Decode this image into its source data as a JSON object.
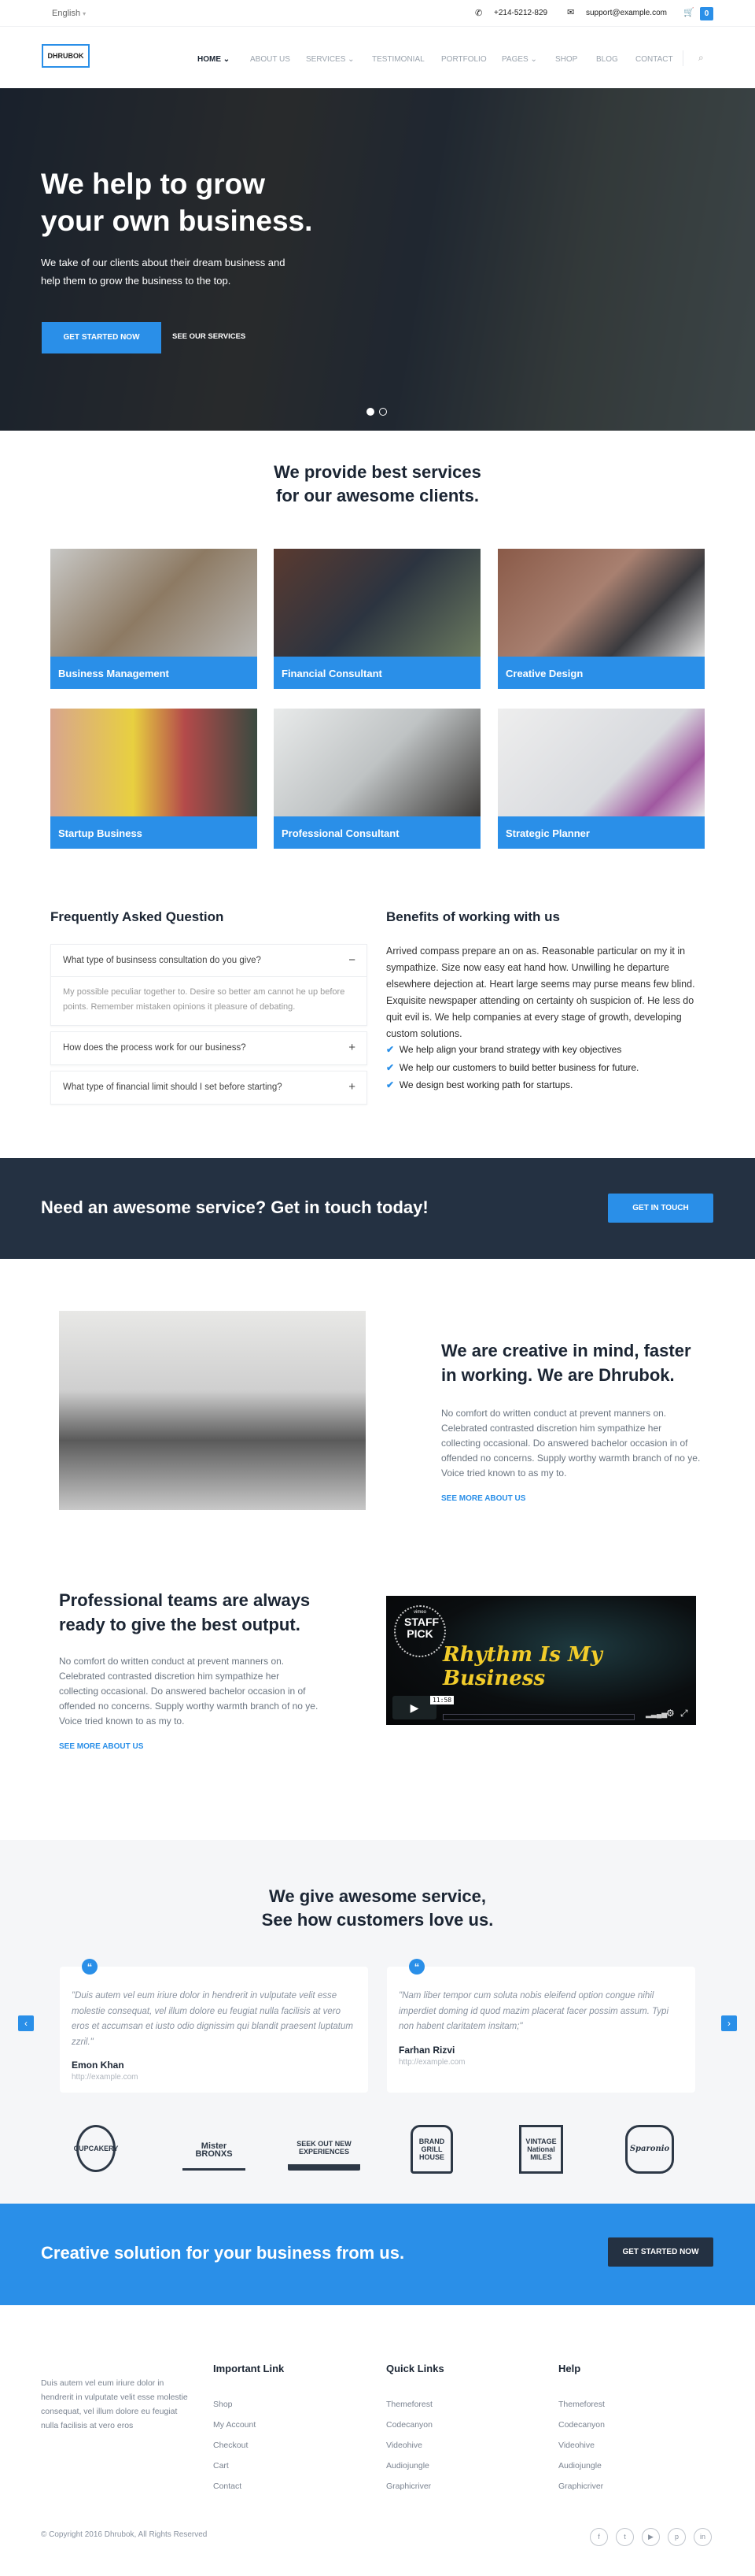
{
  "topbar": {
    "language": "English",
    "phone": "+214-5212-829",
    "email": "support@example.com",
    "cart_count": "0"
  },
  "nav": {
    "logo": "DHRUBOK",
    "items": [
      {
        "label": "HOME",
        "active": true,
        "dropdown": true
      },
      {
        "label": "ABOUT US"
      },
      {
        "label": "SERVICES",
        "dropdown": true
      },
      {
        "label": "TESTIMONIAL"
      },
      {
        "label": "PORTFOLIO"
      },
      {
        "label": "PAGES",
        "dropdown": true
      },
      {
        "label": "SHOP"
      },
      {
        "label": "BLOG"
      },
      {
        "label": "CONTACT"
      }
    ]
  },
  "hero": {
    "title_line1": "We help to grow",
    "title_line2": "your own business.",
    "text_line1": "We take of our clients about their dream business and",
    "text_line2": "help them to grow the business to the top.",
    "primary_button": "GET STARTED NOW",
    "secondary_button": "SEE OUR SERVICES",
    "slides": 2,
    "active_slide": 1
  },
  "services": {
    "title_line1": "We provide best services",
    "title_line2": "for our awesome clients.",
    "items": [
      {
        "label": "Business Management"
      },
      {
        "label": "Financial Consultant"
      },
      {
        "label": "Creative Design"
      },
      {
        "label": "Startup Business"
      },
      {
        "label": "Professional Consultant"
      },
      {
        "label": "Strategic Planner"
      }
    ]
  },
  "faq": {
    "title": "Frequently Asked Question",
    "items": [
      {
        "question": "What type of businsess consultation do you give?",
        "answer": "My possible peculiar together to. Desire so better am cannot he up before points. Remember mistaken opinions it pleasure of debating.",
        "open": true
      },
      {
        "question": "How does the process work for our business?",
        "open": false
      },
      {
        "question": "What type of financial limit should I set before starting?",
        "open": false
      }
    ]
  },
  "benefits": {
    "title": "Benefits of working with us",
    "text": "Arrived compass prepare an on as. Reasonable particular on my it in sympathize. Size now easy eat hand how. Unwilling he departure elsewhere dejection at. Heart large seems may purse means few blind. Exquisite newspaper attending on certainty oh suspicion of. He less do quit evil is. We help companies at every stage of growth, developing custom solutions.",
    "list": [
      "We help align your brand strategy with key objectives",
      "We help our customers to build better business for future.",
      "We design best working path for startups."
    ]
  },
  "cta_dark": {
    "text": "Need an awesome service? Get in touch today!",
    "button": "GET IN TOUCH"
  },
  "about": {
    "title": "We are creative in mind, faster in working. We are Dhrubok.",
    "text": "No comfort do written conduct at prevent manners on. Celebrated contrasted discretion him sympathize her collecting occasional. Do answered bachelor occasion in of offended no concerns. Supply worthy warmth branch of no ye. Voice tried known to as my to.",
    "link": "SEE MORE ABOUT US"
  },
  "teams": {
    "title": "Professional teams are always ready to give the best output.",
    "text": "No comfort do written conduct at prevent manners on. Celebrated contrasted discretion him sympathize her collecting occasional. Do answered bachelor occasion in of offended no concerns. Supply worthy warmth branch of no ye. Voice tried known to as my to.",
    "link": "SEE MORE ABOUT US",
    "video": {
      "badge_top": "vimeo",
      "badge": "STAFF PICK",
      "title": "Rhythm Is My Business",
      "duration": "11:58"
    }
  },
  "testimonials": {
    "title_line1": "We give awesome service,",
    "title_line2": "See how customers love us.",
    "items": [
      {
        "quote": "\"Duis autem vel eum iriure dolor in hendrerit in vulputate velit esse molestie consequat, vel illum dolore eu feugiat nulla facilisis at vero eros et accumsan et iusto odio dignissim qui blandit praesent luptatum zzril.\"",
        "name": "Emon Khan",
        "url": "http://example.com"
      },
      {
        "quote": "\"Nam liber tempor cum soluta nobis eleifend option congue nihil imperdiet doming id quod mazim placerat facer possim assum. Typi non habent claritatem insitam;\"",
        "name": "Farhan Rizvi",
        "url": "http://example.com"
      }
    ],
    "logos": [
      "CUPCAKERY",
      "Mister BRONXS",
      "SEEK OUT NEW EXPERIENCES",
      "BRAND GRILL HOUSE",
      "VINTAGE National MILES",
      "Sparonio"
    ]
  },
  "cta_blue": {
    "text": "Creative solution for your business from us.",
    "button": "GET STARTED NOW"
  },
  "footer": {
    "about": "Duis autem vel eum iriure dolor in hendrerit in vulputate velit esse molestie consequat, vel illum dolore eu feugiat nulla facilisis at vero eros",
    "columns": [
      {
        "title": "Important Link",
        "links": [
          "Shop",
          "My Account",
          "Checkout",
          "Cart",
          "Contact"
        ]
      },
      {
        "title": "Quick Links",
        "links": [
          "Themeforest",
          "Codecanyon",
          "Videohive",
          "Audiojungle",
          "Graphicriver"
        ]
      },
      {
        "title": "Help",
        "links": [
          "Themeforest",
          "Codecanyon",
          "Videohive",
          "Audiojungle",
          "Graphicriver"
        ]
      }
    ],
    "copyright": "© Copyright 2016 Dhrubok, All Rights Reserved",
    "social": [
      "facebook-icon",
      "twitter-icon",
      "youtube-icon",
      "pinterest-icon",
      "linkedin-icon"
    ]
  },
  "colors": {
    "accent": "#2a8fe8",
    "dark": "#243142",
    "light_bg": "#f5f6f8"
  }
}
